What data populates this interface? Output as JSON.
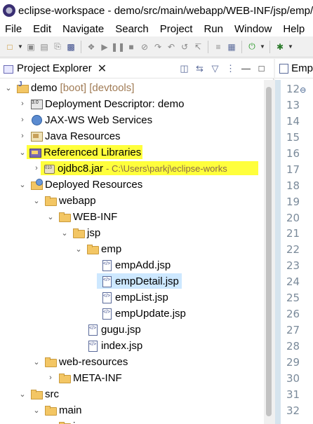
{
  "window": {
    "title": "eclipse-workspace - demo/src/main/webapp/WEB-INF/jsp/emp/empDetail.jsp - Eclipse IDE"
  },
  "menubar": [
    "File",
    "Edit",
    "Navigate",
    "Search",
    "Project",
    "Run",
    "Window",
    "Help"
  ],
  "project_explorer": {
    "tab_label": "Project Explorer",
    "tree": [
      {
        "label": "demo",
        "decor": "[boot] [devtools]",
        "icon": "project-icon",
        "expanded": true,
        "level": 0
      },
      {
        "label": "Deployment Descriptor: demo",
        "icon": "deployment-descriptor-icon",
        "expanded": false,
        "level": 1
      },
      {
        "label": "JAX-WS Web Services",
        "icon": "web-services-icon",
        "expanded": false,
        "level": 1
      },
      {
        "label": "Java Resources",
        "icon": "java-resources-icon",
        "expanded": false,
        "level": 1
      },
      {
        "label": "Referenced Libraries",
        "icon": "library-icon",
        "expanded": true,
        "level": 1,
        "highlight": true
      },
      {
        "label": "ojdbc8.jar",
        "hint": "- C:\\Users\\parkj\\eclipse-works",
        "icon": "jar-icon",
        "expanded": false,
        "level": 2,
        "highlight": true
      },
      {
        "label": "Deployed Resources",
        "icon": "deployed-resources-icon",
        "expanded": true,
        "level": 1
      },
      {
        "label": "webapp",
        "icon": "folder-icon",
        "expanded": true,
        "level": 2
      },
      {
        "label": "WEB-INF",
        "icon": "folder-icon",
        "expanded": true,
        "level": 3
      },
      {
        "label": "jsp",
        "icon": "folder-icon",
        "expanded": true,
        "level": 4
      },
      {
        "label": "emp",
        "icon": "folder-icon",
        "expanded": true,
        "level": 5
      },
      {
        "label": "empAdd.jsp",
        "icon": "jsp-file-icon",
        "level": 6
      },
      {
        "label": "empDetail.jsp",
        "icon": "jsp-file-icon",
        "level": 6,
        "selected": true
      },
      {
        "label": "empList.jsp",
        "icon": "jsp-file-icon",
        "level": 6
      },
      {
        "label": "empUpdate.jsp",
        "icon": "jsp-file-icon",
        "level": 6
      },
      {
        "label": "gugu.jsp",
        "icon": "jsp-file-icon",
        "level": 5
      },
      {
        "label": "index.jsp",
        "icon": "jsp-file-icon",
        "level": 5
      },
      {
        "label": "web-resources",
        "icon": "folder-icon",
        "expanded": true,
        "level": 2
      },
      {
        "label": "META-INF",
        "icon": "folder-icon",
        "expanded": false,
        "level": 3
      },
      {
        "label": "src",
        "icon": "source-folder-icon",
        "expanded": true,
        "level": 1
      },
      {
        "label": "main",
        "icon": "folder-icon",
        "expanded": true,
        "level": 2
      },
      {
        "label": "java",
        "icon": "folder-icon",
        "expanded": true,
        "level": 3
      }
    ]
  },
  "editor": {
    "tab_label": "Emp",
    "line_numbers": [
      "12",
      "13",
      "14",
      "15",
      "16",
      "17",
      "18",
      "19",
      "20",
      "21",
      "22",
      "23",
      "24",
      "25",
      "26",
      "27",
      "28",
      "29",
      "30",
      "31",
      "32"
    ],
    "folded_marker": "⊖"
  }
}
